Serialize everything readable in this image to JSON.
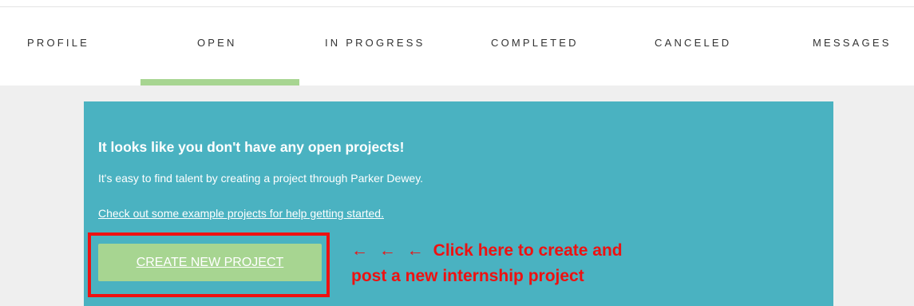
{
  "tabs": [
    {
      "label": "PROFILE",
      "active": false
    },
    {
      "label": "OPEN",
      "active": true
    },
    {
      "label": "IN PROGRESS",
      "active": false
    },
    {
      "label": "COMPLETED",
      "active": false
    },
    {
      "label": "CANCELED",
      "active": false
    },
    {
      "label": "MESSAGES",
      "active": false
    }
  ],
  "panel": {
    "title": "It looks like you don't have any open projects!",
    "text": "It's easy to find talent by creating a project through Parker Dewey.",
    "link": "Check out some example projects for help getting started.",
    "button": "CREATE NEW PROJECT"
  },
  "annotation": {
    "arrows": "← ← ←",
    "line1": "Click here to create and",
    "line2": "post a new internship project"
  },
  "colors": {
    "accent_green": "#a7d591",
    "panel_teal": "#4ab2c1",
    "annotation_red": "#ee1111",
    "background_gray": "#efefef"
  }
}
